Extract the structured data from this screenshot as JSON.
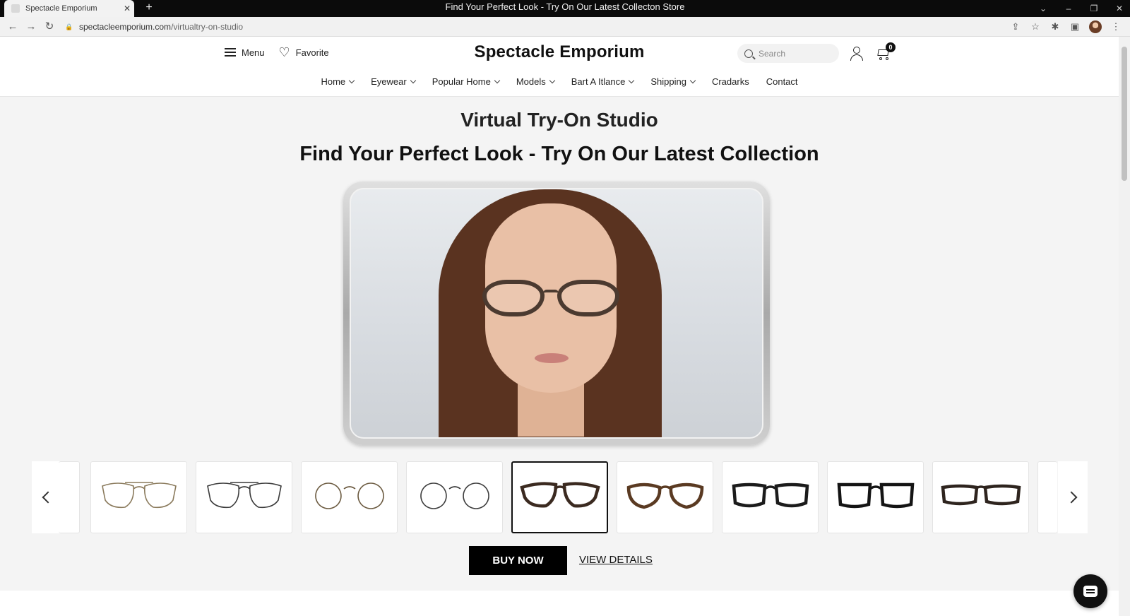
{
  "browser": {
    "tab_title": "Spectacle Emporium",
    "tab_close": "✕",
    "new_tab": "+",
    "window_title": "Find Your Perfect Look - Try On Our Latest Collecton Store",
    "url_domain": "spectacleemporium.com",
    "url_path": "/virtualtry-on-studio"
  },
  "header": {
    "menu_label": "Menu",
    "favorite_label": "Favorite",
    "logo": "Spectacle Emporium",
    "search_placeholder": "Search",
    "cart_count": "0"
  },
  "nav": {
    "items": [
      {
        "label": "Home",
        "dropdown": true
      },
      {
        "label": "Eyewear",
        "dropdown": true
      },
      {
        "label": "Popular Home",
        "dropdown": true
      },
      {
        "label": "Models",
        "dropdown": true
      },
      {
        "label": "Bart A Itlance",
        "dropdown": true
      },
      {
        "label": "Shipping",
        "dropdown": true
      },
      {
        "label": "Cradarks",
        "dropdown": false
      },
      {
        "label": "Contact",
        "dropdown": false
      }
    ]
  },
  "main": {
    "studio_title": "Virtual Try-On Studio",
    "headline": "Find Your Perfect Look - Try On Our Latest Collection",
    "buy_label": "BUY NOW",
    "details_label": "VIEW DETAILS"
  },
  "carousel": {
    "selected_index": 4,
    "frames": [
      {
        "style": "aviator-thin",
        "color": "#8a7a5c"
      },
      {
        "style": "aviator-dark",
        "color": "#3a3a3a"
      },
      {
        "style": "round-thin-gold",
        "color": "#6b5a40"
      },
      {
        "style": "round-thin-dark",
        "color": "#3c3c3c"
      },
      {
        "style": "cat-eye-tortoise",
        "color": "#3b2a20"
      },
      {
        "style": "round-tortoise",
        "color": "#5a3a22"
      },
      {
        "style": "square-black",
        "color": "#1b1b1b"
      },
      {
        "style": "square-bold-black",
        "color": "#141414"
      },
      {
        "style": "rect-tortoise",
        "color": "#2e241e"
      }
    ]
  },
  "colors": {
    "accent": "#000000",
    "page_bg": "#f4f4f4",
    "header_bg": "#ffffff"
  }
}
